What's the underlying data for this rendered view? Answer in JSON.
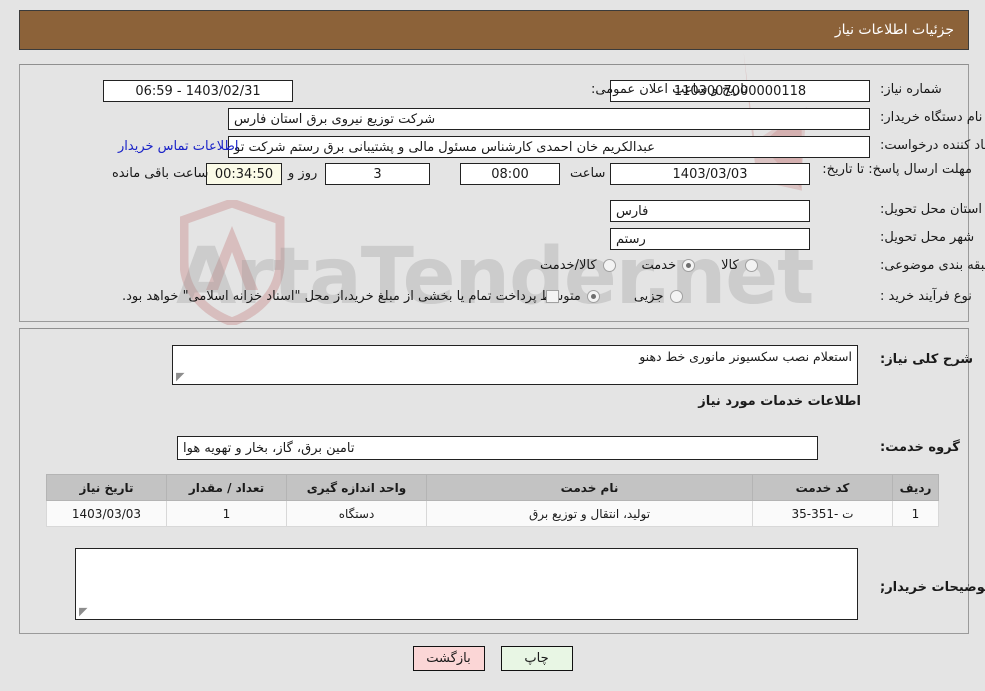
{
  "header": {
    "title": "جزئیات اطلاعات نیاز"
  },
  "watermark": {
    "text": "ArtaTender.net"
  },
  "form": {
    "need_number_label": "شماره نیاز:",
    "need_number_value": "1103007000000118",
    "announce_label": "تاریخ و ساعت اعلان عمومی:",
    "announce_value": "1403/02/31 - 06:59",
    "buyer_org_label": "نام دستگاه خریدار:",
    "buyer_org_value": "شرکت توزیع نیروی برق استان فارس",
    "creator_label": "ایجاد کننده درخواست:",
    "creator_value": "عبدالکریم خان احمدی کارشناس مسئول مالی و پشتیبانی برق رستم شرکت تو",
    "contact_link": "اطلاعات تماس خریدار",
    "deadline_label": "مهلت ارسال پاسخ: تا تاریخ:",
    "deadline_date": "1403/03/03",
    "hour_label": "ساعت",
    "deadline_time": "08:00",
    "days_value": "3",
    "days_label": "روز و",
    "remaining_value": "00:34:50",
    "remaining_label": "ساعت باقی مانده",
    "province_label": "استان محل تحویل:",
    "province_value": "فارس",
    "city_label": "شهر محل تحویل:",
    "city_value": "رستم",
    "category_label": "طبقه بندی موضوعی:",
    "category_options": [
      {
        "label": "کالا",
        "selected": false
      },
      {
        "label": "خدمت",
        "selected": true
      },
      {
        "label": "کالا/خدمت",
        "selected": false
      }
    ],
    "process_label": "نوع فرآیند خرید :",
    "process_options": [
      {
        "label": "جزیی",
        "selected": false
      },
      {
        "label": "متوسط",
        "selected": true
      }
    ],
    "treasury_checkbox_checked": false,
    "treasury_text": "پرداخت تمام یا بخشی از مبلغ خرید،از محل \"اسناد خزانه اسلامی\" خواهد بود."
  },
  "need": {
    "summary_label": "شرح کلی نیاز:",
    "summary_value": "استعلام نصب سکسیونر مانوری خط دهنو",
    "services_heading": "اطلاعات خدمات مورد نیاز",
    "service_group_label": "گروه خدمت:",
    "service_group_value": "تامین برق، گاز، بخار و تهویه هوا"
  },
  "table": {
    "columns": [
      "ردیف",
      "کد خدمت",
      "نام خدمت",
      "واحد اندازه گیری",
      "تعداد / مقدار",
      "تاریخ نیاز"
    ],
    "rows": [
      {
        "row_no": "1",
        "service_code": "ت -351-35",
        "service_name": "تولید، انتقال و توزیع برق",
        "unit": "دستگاه",
        "quantity": "1",
        "need_date": "1403/03/03"
      }
    ]
  },
  "notes": {
    "label": "توضیحات خریدار;",
    "value": ""
  },
  "footer": {
    "print_label": "چاپ",
    "back_label": "بازگشت"
  }
}
